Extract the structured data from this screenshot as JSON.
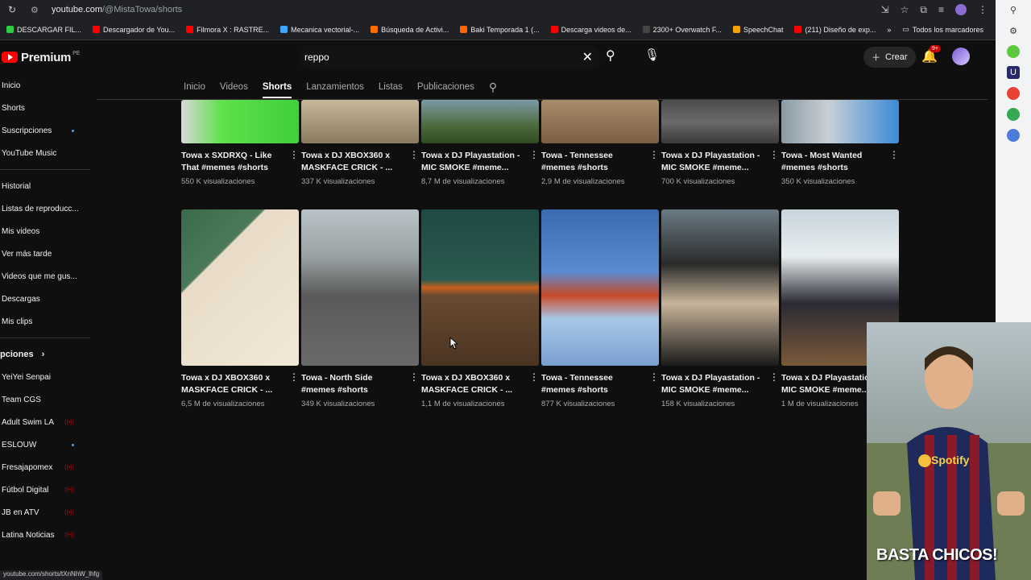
{
  "browser": {
    "url_domain": "youtube.com",
    "url_path": "/@MistaTowa/shorts",
    "bookmarks": [
      {
        "label": "DESCARGAR FIL...",
        "color": "#2ecc40"
      },
      {
        "label": "Descargador de You...",
        "color": "#ff0000"
      },
      {
        "label": "Filmora X : RASTRE...",
        "color": "#ff0000"
      },
      {
        "label": "Mecanica vectorial-...",
        "color": "#3ea6ff"
      },
      {
        "label": "Búsqueda de Activi...",
        "color": "#ff6d00"
      },
      {
        "label": "Baki Temporada 1 (...",
        "color": "#ff6600"
      },
      {
        "label": "Descarga videos de...",
        "color": "#ff0000"
      },
      {
        "label": "2300+ Overwatch F...",
        "color": "#444444"
      },
      {
        "label": "SpeechChat",
        "color": "#f4a300"
      },
      {
        "label": "(211) Diseño de exp...",
        "color": "#ff0000"
      }
    ],
    "all_bookmarks": "Todos los marcadores",
    "status_url": "youtube.com/shorts/tXnNhW_lhfg"
  },
  "header": {
    "logo": "Premium",
    "region": "PE",
    "search_value": "reppo",
    "create_label": "Crear",
    "notif_badge": "9+"
  },
  "sidebar": {
    "top": [
      "Inicio",
      "Shorts",
      "Suscripciones",
      "YouTube Music"
    ],
    "you": [
      "Historial",
      "Listas de reproducc...",
      "Mis videos",
      "Ver más tarde",
      "Videos que me gus...",
      "Descargas",
      "Mis clips"
    ],
    "subs_header": "pciones",
    "subs": [
      {
        "label": "YeiYei Senpai",
        "mark": ""
      },
      {
        "label": "Team CGS",
        "mark": ""
      },
      {
        "label": "Adult Swim LA",
        "mark": "live"
      },
      {
        "label": "ESLOUW",
        "mark": "dot"
      },
      {
        "label": "Fresajapomex",
        "mark": "live"
      },
      {
        "label": "Fútbol Digital",
        "mark": "live"
      },
      {
        "label": "JB en ATV",
        "mark": "live"
      },
      {
        "label": "Latina Noticias",
        "mark": "live"
      }
    ]
  },
  "tabs": [
    "Inicio",
    "Videos",
    "Shorts",
    "Lanzamientos",
    "Listas",
    "Publicaciones"
  ],
  "active_tab": "Shorts",
  "row1": [
    {
      "title": "Towa x SXDRXQ - Like That #memes #shorts",
      "views": "550 K visualizaciones",
      "bg": "linear-gradient(90deg,#d8d8d8 0%,#5ee04a 35%,#3fd03a 100%)"
    },
    {
      "title": "Towa x DJ XBOX360 x MASKFACE CRICK - ...",
      "views": "337 K visualizaciones",
      "bg": "linear-gradient(180deg,#c7b89a 0%,#8a7a5f 100%)"
    },
    {
      "title": "Towa x DJ Playastation - MIC SMOKE #meme...",
      "views": "8,7 M de visualizaciones",
      "bg": "linear-gradient(180deg,#7c9aa8 0%,#4d6a3a 60%,#2f4a22 100%)"
    },
    {
      "title": "Towa - Tennessee #memes #shorts",
      "views": "2,9 M de visualizaciones",
      "bg": "linear-gradient(180deg,#a98c6a 0%,#7a5f44 100%)"
    },
    {
      "title": "Towa x DJ Playastation - MIC SMOKE #meme...",
      "views": "700 K visualizaciones",
      "bg": "linear-gradient(180deg,#4a4a4a 0%,#6a6a6a 50%,#3a3a3a 100%)"
    },
    {
      "title": "Towa - Most Wanted #memes #shorts",
      "views": "350 K visualizaciones",
      "bg": "linear-gradient(90deg,#8a9aa4 0%,#c9d0d4 40%,#3c8ad8 100%)"
    }
  ],
  "row2": [
    {
      "title": "Towa x DJ XBOX360 x MASKFACE CRICK - ...",
      "views": "6,5 M de visualizaciones",
      "bg": "linear-gradient(135deg,#3a6a4a 0%,#4a7a5a 30%,#e8dcc8 31%,#f2e8d8 100%)"
    },
    {
      "title": "Towa - North Side #memes #shorts",
      "views": "349 K visualizaciones",
      "bg": "linear-gradient(180deg,#b9c2c6 0%,#9aa2a4 30%,#5a5a5a 55%,#6a6a6a 100%)"
    },
    {
      "title": "Towa x DJ XBOX360 x MASKFACE CRICK - ...",
      "views": "1,1 M de visualizaciones",
      "bg": "linear-gradient(180deg,#1f4a44 0%,#2a5a50 45%,#c8601e 50%,#6a4a30 55%,#4a3422 100%)"
    },
    {
      "title": "Towa - Tennessee #memes #shorts",
      "views": "877 K visualizaciones",
      "bg": "linear-gradient(180deg,#3a6ab0 0%,#5a8ad0 40%,#c84a2a 55%,#a8c8e8 70%,#7aa0d0 100%)"
    },
    {
      "title": "Towa x DJ Playastation - MIC SMOKE #meme...",
      "views": "158 K visualizaciones",
      "bg": "linear-gradient(180deg,#6a7a84 0%,#2a2a2a 35%,#c8b49a 60%,#1a1a1a 100%)"
    },
    {
      "title": "Towa x DJ Playastation - MIC SMOKE #meme...",
      "views": "1 M de visualizaciones",
      "bg": "linear-gradient(180deg,#c8d4dc 0%,#e8eef0 30%,#2a2a34 60%,#7a5a3a 100%)"
    }
  ],
  "webcam": {
    "caption": "BASTA CHICOS!",
    "shirt_brand": "Spotify"
  }
}
